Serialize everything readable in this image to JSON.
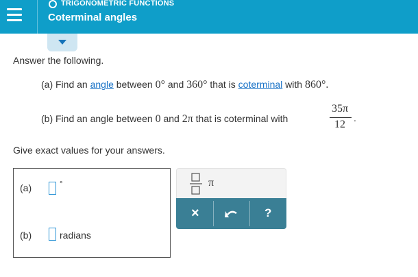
{
  "header": {
    "topic": "TRIGONOMETRIC FUNCTIONS",
    "title": "Coterminal angles"
  },
  "problem": {
    "intro": "Answer the following.",
    "part_a": {
      "prefix": "(a) Find an",
      "link_angle": "angle",
      "between": "between",
      "val1": "0°",
      "and": "and",
      "val2": "360°",
      "that_is": "that is",
      "link_coterminal": "coterminal",
      "with": "with",
      "val3": "860°."
    },
    "part_b": {
      "text": "(b) Find an angle between",
      "val_zero": "0",
      "and": "and",
      "val_2pi": "2π",
      "text2": "that is coterminal with",
      "numerator": "35π",
      "denominator": "12",
      "period": "."
    },
    "instruction": "Give exact values for your answers."
  },
  "answers": {
    "a_label": "(a)",
    "a_value": "",
    "a_unit": "°",
    "b_label": "(b)",
    "b_value": "",
    "b_unit": "radians"
  },
  "keypad": {
    "pi_label": "π",
    "clear_label": "×",
    "help_label": "?",
    "fraction_key": "fraction-icon",
    "undo_key": "undo-icon"
  },
  "colors": {
    "header_bg": "#0f9ec9",
    "link": "#1a73c7",
    "input_border": "#2a93d5",
    "keypad_bottom": "#3a7f95"
  }
}
